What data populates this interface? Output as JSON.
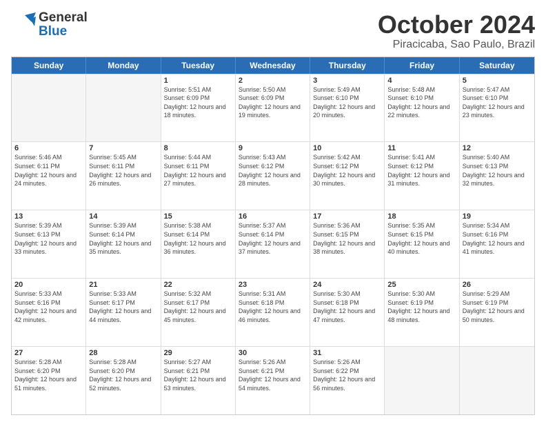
{
  "header": {
    "logo_general": "General",
    "logo_blue": "Blue",
    "month_title": "October 2024",
    "location": "Piracicaba, Sao Paulo, Brazil"
  },
  "calendar": {
    "days_of_week": [
      "Sunday",
      "Monday",
      "Tuesday",
      "Wednesday",
      "Thursday",
      "Friday",
      "Saturday"
    ],
    "weeks": [
      [
        {
          "day": "",
          "sunrise": "",
          "sunset": "",
          "daylight": "",
          "empty": true
        },
        {
          "day": "",
          "sunrise": "",
          "sunset": "",
          "daylight": "",
          "empty": true
        },
        {
          "day": "1",
          "sunrise": "Sunrise: 5:51 AM",
          "sunset": "Sunset: 6:09 PM",
          "daylight": "Daylight: 12 hours and 18 minutes.",
          "empty": false
        },
        {
          "day": "2",
          "sunrise": "Sunrise: 5:50 AM",
          "sunset": "Sunset: 6:09 PM",
          "daylight": "Daylight: 12 hours and 19 minutes.",
          "empty": false
        },
        {
          "day": "3",
          "sunrise": "Sunrise: 5:49 AM",
          "sunset": "Sunset: 6:10 PM",
          "daylight": "Daylight: 12 hours and 20 minutes.",
          "empty": false
        },
        {
          "day": "4",
          "sunrise": "Sunrise: 5:48 AM",
          "sunset": "Sunset: 6:10 PM",
          "daylight": "Daylight: 12 hours and 22 minutes.",
          "empty": false
        },
        {
          "day": "5",
          "sunrise": "Sunrise: 5:47 AM",
          "sunset": "Sunset: 6:10 PM",
          "daylight": "Daylight: 12 hours and 23 minutes.",
          "empty": false
        }
      ],
      [
        {
          "day": "6",
          "sunrise": "Sunrise: 5:46 AM",
          "sunset": "Sunset: 6:11 PM",
          "daylight": "Daylight: 12 hours and 24 minutes.",
          "empty": false
        },
        {
          "day": "7",
          "sunrise": "Sunrise: 5:45 AM",
          "sunset": "Sunset: 6:11 PM",
          "daylight": "Daylight: 12 hours and 26 minutes.",
          "empty": false
        },
        {
          "day": "8",
          "sunrise": "Sunrise: 5:44 AM",
          "sunset": "Sunset: 6:11 PM",
          "daylight": "Daylight: 12 hours and 27 minutes.",
          "empty": false
        },
        {
          "day": "9",
          "sunrise": "Sunrise: 5:43 AM",
          "sunset": "Sunset: 6:12 PM",
          "daylight": "Daylight: 12 hours and 28 minutes.",
          "empty": false
        },
        {
          "day": "10",
          "sunrise": "Sunrise: 5:42 AM",
          "sunset": "Sunset: 6:12 PM",
          "daylight": "Daylight: 12 hours and 30 minutes.",
          "empty": false
        },
        {
          "day": "11",
          "sunrise": "Sunrise: 5:41 AM",
          "sunset": "Sunset: 6:12 PM",
          "daylight": "Daylight: 12 hours and 31 minutes.",
          "empty": false
        },
        {
          "day": "12",
          "sunrise": "Sunrise: 5:40 AM",
          "sunset": "Sunset: 6:13 PM",
          "daylight": "Daylight: 12 hours and 32 minutes.",
          "empty": false
        }
      ],
      [
        {
          "day": "13",
          "sunrise": "Sunrise: 5:39 AM",
          "sunset": "Sunset: 6:13 PM",
          "daylight": "Daylight: 12 hours and 33 minutes.",
          "empty": false
        },
        {
          "day": "14",
          "sunrise": "Sunrise: 5:39 AM",
          "sunset": "Sunset: 6:14 PM",
          "daylight": "Daylight: 12 hours and 35 minutes.",
          "empty": false
        },
        {
          "day": "15",
          "sunrise": "Sunrise: 5:38 AM",
          "sunset": "Sunset: 6:14 PM",
          "daylight": "Daylight: 12 hours and 36 minutes.",
          "empty": false
        },
        {
          "day": "16",
          "sunrise": "Sunrise: 5:37 AM",
          "sunset": "Sunset: 6:14 PM",
          "daylight": "Daylight: 12 hours and 37 minutes.",
          "empty": false
        },
        {
          "day": "17",
          "sunrise": "Sunrise: 5:36 AM",
          "sunset": "Sunset: 6:15 PM",
          "daylight": "Daylight: 12 hours and 38 minutes.",
          "empty": false
        },
        {
          "day": "18",
          "sunrise": "Sunrise: 5:35 AM",
          "sunset": "Sunset: 6:15 PM",
          "daylight": "Daylight: 12 hours and 40 minutes.",
          "empty": false
        },
        {
          "day": "19",
          "sunrise": "Sunrise: 5:34 AM",
          "sunset": "Sunset: 6:16 PM",
          "daylight": "Daylight: 12 hours and 41 minutes.",
          "empty": false
        }
      ],
      [
        {
          "day": "20",
          "sunrise": "Sunrise: 5:33 AM",
          "sunset": "Sunset: 6:16 PM",
          "daylight": "Daylight: 12 hours and 42 minutes.",
          "empty": false
        },
        {
          "day": "21",
          "sunrise": "Sunrise: 5:33 AM",
          "sunset": "Sunset: 6:17 PM",
          "daylight": "Daylight: 12 hours and 44 minutes.",
          "empty": false
        },
        {
          "day": "22",
          "sunrise": "Sunrise: 5:32 AM",
          "sunset": "Sunset: 6:17 PM",
          "daylight": "Daylight: 12 hours and 45 minutes.",
          "empty": false
        },
        {
          "day": "23",
          "sunrise": "Sunrise: 5:31 AM",
          "sunset": "Sunset: 6:18 PM",
          "daylight": "Daylight: 12 hours and 46 minutes.",
          "empty": false
        },
        {
          "day": "24",
          "sunrise": "Sunrise: 5:30 AM",
          "sunset": "Sunset: 6:18 PM",
          "daylight": "Daylight: 12 hours and 47 minutes.",
          "empty": false
        },
        {
          "day": "25",
          "sunrise": "Sunrise: 5:30 AM",
          "sunset": "Sunset: 6:19 PM",
          "daylight": "Daylight: 12 hours and 48 minutes.",
          "empty": false
        },
        {
          "day": "26",
          "sunrise": "Sunrise: 5:29 AM",
          "sunset": "Sunset: 6:19 PM",
          "daylight": "Daylight: 12 hours and 50 minutes.",
          "empty": false
        }
      ],
      [
        {
          "day": "27",
          "sunrise": "Sunrise: 5:28 AM",
          "sunset": "Sunset: 6:20 PM",
          "daylight": "Daylight: 12 hours and 51 minutes.",
          "empty": false
        },
        {
          "day": "28",
          "sunrise": "Sunrise: 5:28 AM",
          "sunset": "Sunset: 6:20 PM",
          "daylight": "Daylight: 12 hours and 52 minutes.",
          "empty": false
        },
        {
          "day": "29",
          "sunrise": "Sunrise: 5:27 AM",
          "sunset": "Sunset: 6:21 PM",
          "daylight": "Daylight: 12 hours and 53 minutes.",
          "empty": false
        },
        {
          "day": "30",
          "sunrise": "Sunrise: 5:26 AM",
          "sunset": "Sunset: 6:21 PM",
          "daylight": "Daylight: 12 hours and 54 minutes.",
          "empty": false
        },
        {
          "day": "31",
          "sunrise": "Sunrise: 5:26 AM",
          "sunset": "Sunset: 6:22 PM",
          "daylight": "Daylight: 12 hours and 56 minutes.",
          "empty": false
        },
        {
          "day": "",
          "sunrise": "",
          "sunset": "",
          "daylight": "",
          "empty": true
        },
        {
          "day": "",
          "sunrise": "",
          "sunset": "",
          "daylight": "",
          "empty": true
        }
      ]
    ]
  }
}
